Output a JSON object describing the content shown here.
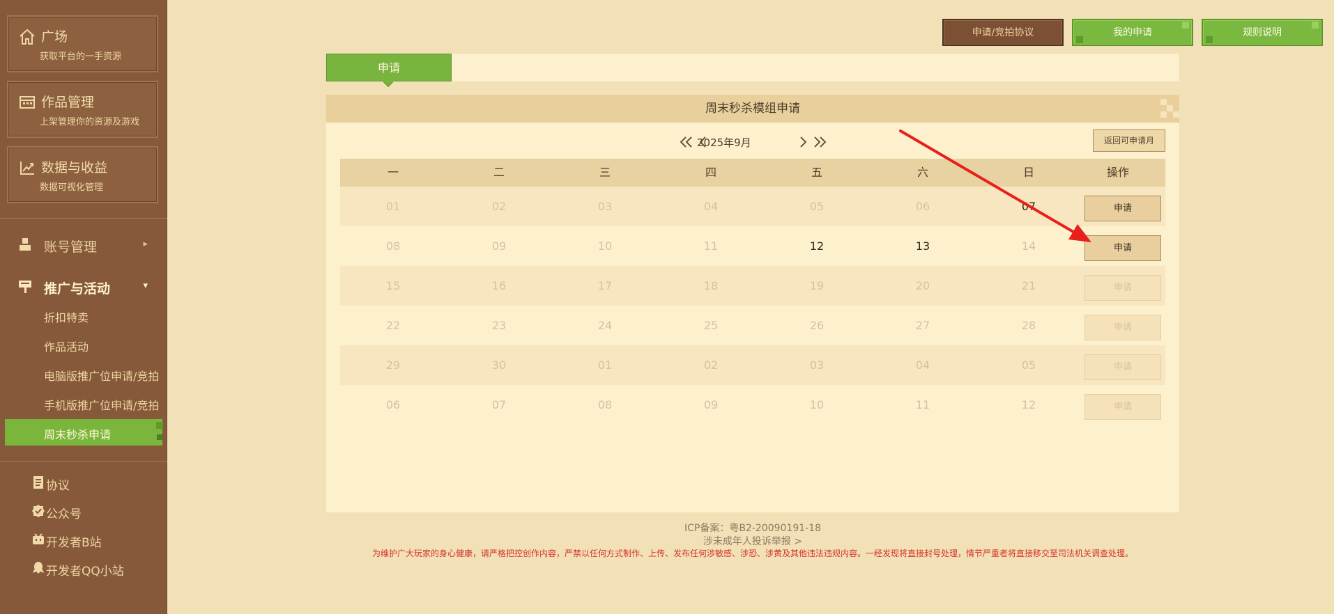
{
  "sidebar": {
    "cards": [
      {
        "title": "广场",
        "subtitle": "获取平台的一手资源",
        "icon": "home-icon"
      },
      {
        "title": "作品管理",
        "subtitle": "上架管理你的资源及游戏",
        "icon": "folder-icon"
      },
      {
        "title": "数据与收益",
        "subtitle": "数据可视化管理",
        "icon": "chart-icon"
      }
    ],
    "groups": [
      {
        "label": "账号管理",
        "icon": "user-icon",
        "caret": "▸"
      },
      {
        "label": "推广与活动",
        "icon": "signboard-icon",
        "caret": "▾"
      }
    ],
    "sub_items": [
      {
        "label": "折扣特卖"
      },
      {
        "label": "作品活动"
      },
      {
        "label": "电脑版推广位申请/竞拍"
      },
      {
        "label": "手机版推广位申请/竞拍"
      },
      {
        "label": "周末秒杀申请"
      }
    ],
    "bottom_links": [
      {
        "label": "协议",
        "icon": "document-icon"
      },
      {
        "label": "公众号",
        "icon": "verified-icon"
      },
      {
        "label": "开发者B站",
        "icon": "bilibili-icon"
      },
      {
        "label": "开发者QQ小站",
        "icon": "qq-icon"
      }
    ]
  },
  "top_buttons": {
    "agreement": "申请/竞拍协议",
    "my_apply": "我的申请",
    "rules": "规则说明"
  },
  "tab": {
    "label": "申请"
  },
  "panel": {
    "title": "周末秒杀模组申请",
    "month": "2025年9月",
    "return_label": "返回可申请月",
    "weekdays": [
      "一",
      "二",
      "三",
      "四",
      "五",
      "六",
      "日"
    ],
    "op_header": "操作",
    "apply_label": "申请",
    "weeks": [
      [
        "01",
        "02",
        "03",
        "04",
        "05",
        "06",
        "07"
      ],
      [
        "08",
        "09",
        "10",
        "11",
        "12",
        "13",
        "14"
      ],
      [
        "15",
        "16",
        "17",
        "18",
        "19",
        "20",
        "21"
      ],
      [
        "22",
        "23",
        "24",
        "25",
        "26",
        "27",
        "28"
      ],
      [
        "29",
        "30",
        "01",
        "02",
        "03",
        "04",
        "05"
      ],
      [
        "06",
        "07",
        "08",
        "09",
        "10",
        "11",
        "12"
      ]
    ]
  },
  "footer": {
    "icp": "ICP备案：粤B2-20090191-18",
    "report": "涉未成年人投诉举报 >",
    "warning": "为维护广大玩家的身心健康，请严格把控创作内容，严禁以任何方式制作、上传、发布任何涉敏感、涉恐、涉黄及其他违法违规内容。一经发现将直接封号处理，情节严重者将直接移交至司法机关调查处理。"
  },
  "colors": {
    "sidebar_bg": "#85593a",
    "accent_green": "#79b43e",
    "page_bg": "#f2e1b6",
    "warning_red": "#d6322b",
    "annotation_red": "#e8201c"
  }
}
